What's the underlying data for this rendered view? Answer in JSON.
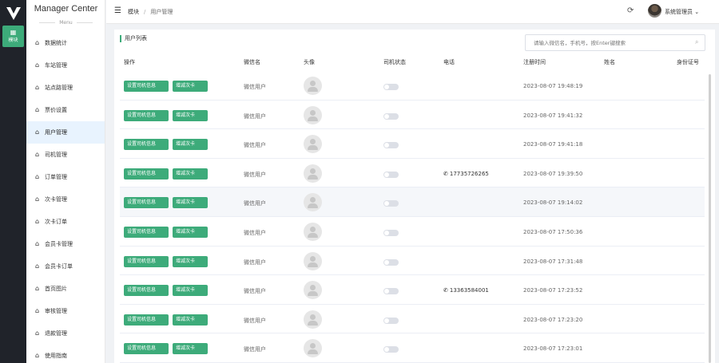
{
  "rail": {
    "module_icon": "grid-icon",
    "module_label": "模块"
  },
  "sidebar": {
    "brand": "Manager Center",
    "subtitle": "Menu",
    "items": [
      {
        "label": "数据统计",
        "icon": "home-icon"
      },
      {
        "label": "车站管理",
        "icon": "home-icon"
      },
      {
        "label": "站点路管理",
        "icon": "home-icon"
      },
      {
        "label": "票价设置",
        "icon": "home-icon"
      },
      {
        "label": "用户管理",
        "icon": "home-icon"
      },
      {
        "label": "司机管理",
        "icon": "home-icon"
      },
      {
        "label": "订单管理",
        "icon": "home-icon"
      },
      {
        "label": "次卡管理",
        "icon": "home-icon"
      },
      {
        "label": "次卡订单",
        "icon": "home-icon"
      },
      {
        "label": "会员卡管理",
        "icon": "home-icon"
      },
      {
        "label": "会员卡订单",
        "icon": "home-icon"
      },
      {
        "label": "首页图片",
        "icon": "home-icon"
      },
      {
        "label": "审核管理",
        "icon": "home-icon"
      },
      {
        "label": "退款管理",
        "icon": "home-icon"
      },
      {
        "label": "使用指南",
        "icon": "home-icon"
      }
    ],
    "active_index": 4
  },
  "topbar": {
    "breadcrumb": [
      "模块",
      "用户管理"
    ],
    "user_name": "系统管理员",
    "icons": [
      "menu-icon",
      "refresh-icon",
      "chevron-down-icon"
    ]
  },
  "panel": {
    "title": "用户列表",
    "search_placeholder": "请输入微信名，手机号，按Enter键搜索"
  },
  "table": {
    "columns": [
      "操作",
      "微信名",
      "头像",
      "司机状态",
      "电话",
      "注册时间",
      "姓名",
      "身份证号"
    ],
    "action1": "设置司机信息",
    "action2": "增减次卡",
    "rows": [
      {
        "nickname": "微信用户",
        "phone": "",
        "registered": "2023-08-07 19:48:19",
        "driver_on": false
      },
      {
        "nickname": "微信用户",
        "phone": "",
        "registered": "2023-08-07 19:41:32",
        "driver_on": false
      },
      {
        "nickname": "微信用户",
        "phone": "",
        "registered": "2023-08-07 19:41:18",
        "driver_on": false
      },
      {
        "nickname": "微信用户",
        "phone": "17735726265",
        "registered": "2023-08-07 19:39:50",
        "driver_on": false
      },
      {
        "nickname": "微信用户",
        "phone": "",
        "registered": "2023-08-07 19:14:02",
        "driver_on": false
      },
      {
        "nickname": "微信用户",
        "phone": "",
        "registered": "2023-08-07 17:50:36",
        "driver_on": false
      },
      {
        "nickname": "微信用户",
        "phone": "",
        "registered": "2023-08-07 17:31:48",
        "driver_on": false
      },
      {
        "nickname": "微信用户",
        "phone": "13363584001",
        "registered": "2023-08-07 17:23:52",
        "driver_on": false
      },
      {
        "nickname": "微信用户",
        "phone": "",
        "registered": "2023-08-07 17:23:20",
        "driver_on": false
      },
      {
        "nickname": "微信用户",
        "phone": "",
        "registered": "2023-08-07 17:23:01",
        "driver_on": false
      }
    ],
    "highlighted_row": 4
  },
  "colors": {
    "accent": "#3dab7a",
    "rail_bg": "#20232a"
  }
}
